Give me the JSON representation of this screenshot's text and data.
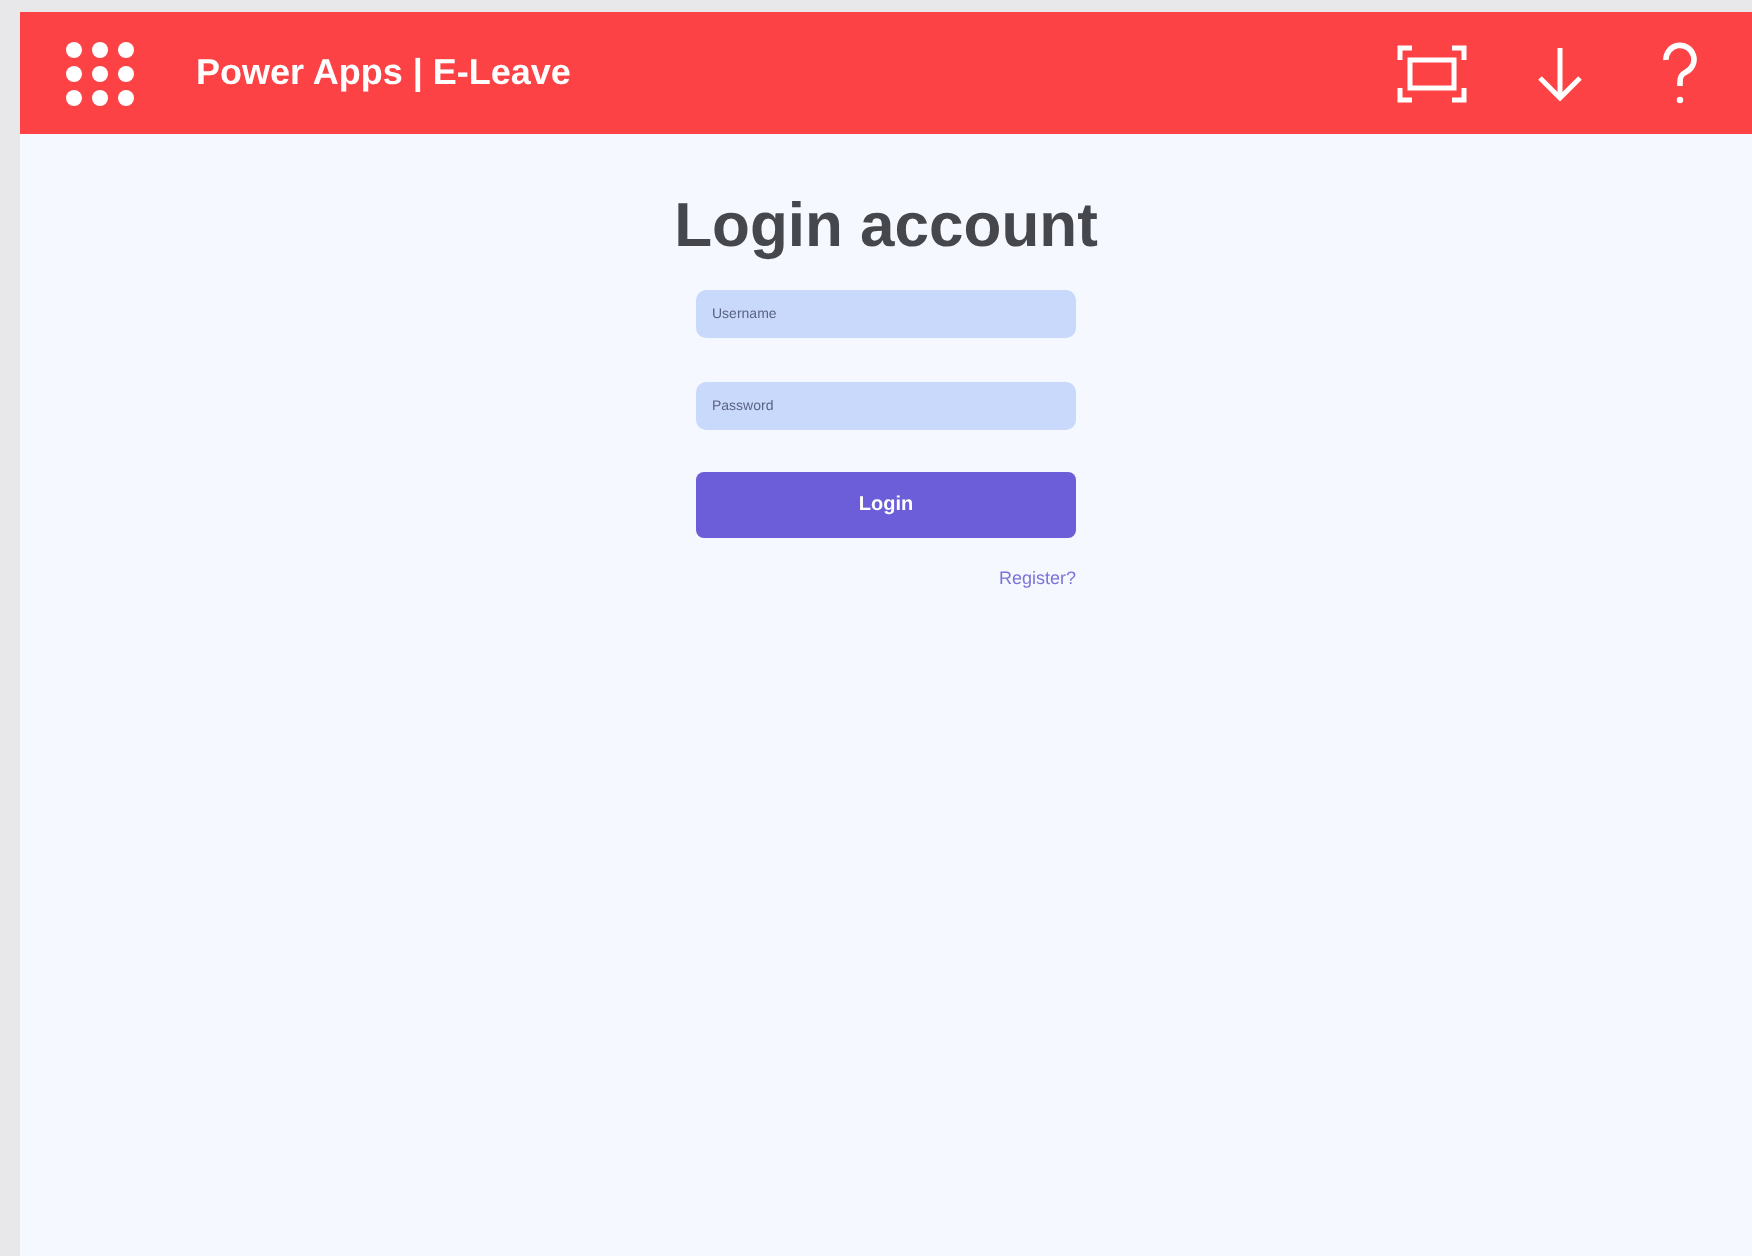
{
  "header": {
    "title": "Power Apps | E-Leave"
  },
  "login": {
    "heading": "Login account",
    "username": {
      "placeholder": "Username"
    },
    "password": {
      "placeholder": "Password"
    },
    "button": "Login",
    "register_link": "Register?"
  }
}
